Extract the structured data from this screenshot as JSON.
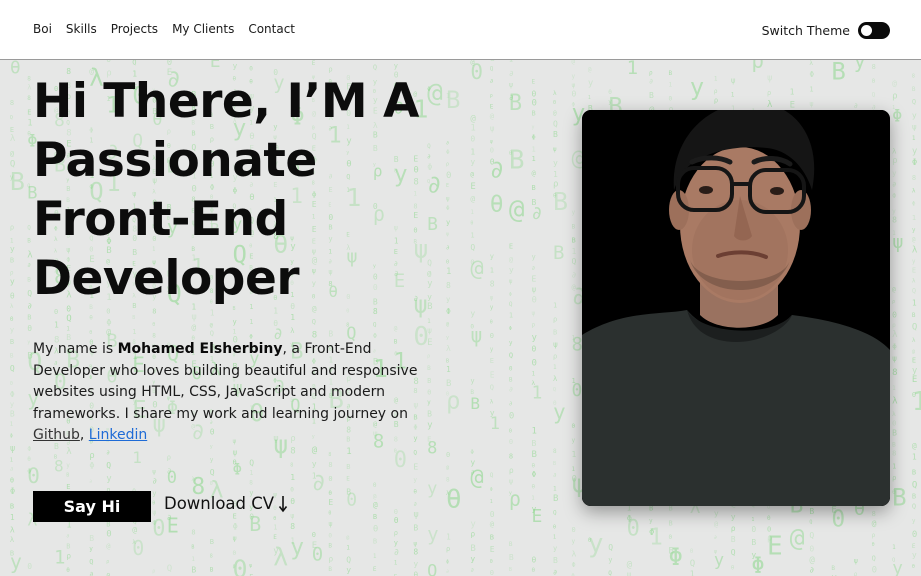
{
  "nav": {
    "links": [
      "Boi",
      "Skills",
      "Projects",
      "My Clients",
      "Contact"
    ],
    "theme_label": "Switch Theme",
    "theme_toggle_state": "off"
  },
  "hero": {
    "headline_lines": [
      "Hi There, I’M A",
      "Passionate",
      "Front-End",
      "Developer"
    ],
    "bio": {
      "intro": "My name is ",
      "name": "Mohamed Elsherbiny",
      "rest": ", a Front-End Developer who loves building beautiful and responsive websites using HTML, CSS, JavaScript and modern frameworks. I share my work and learning journey on ",
      "github": "Github",
      "separator": ", ",
      "linkedin": "Linkedin"
    },
    "say_hi_label": "Say Hi",
    "download_label": "Download CV",
    "download_icon": "arrow-down-icon",
    "photo_icon": "profile-photo"
  },
  "colors": {
    "background": "#e6e7e6",
    "matrix_glyph": "#7fd67f",
    "button_bg": "#000000",
    "link_linkedin": "#1e6bd6",
    "card_bg": "#000000"
  }
}
